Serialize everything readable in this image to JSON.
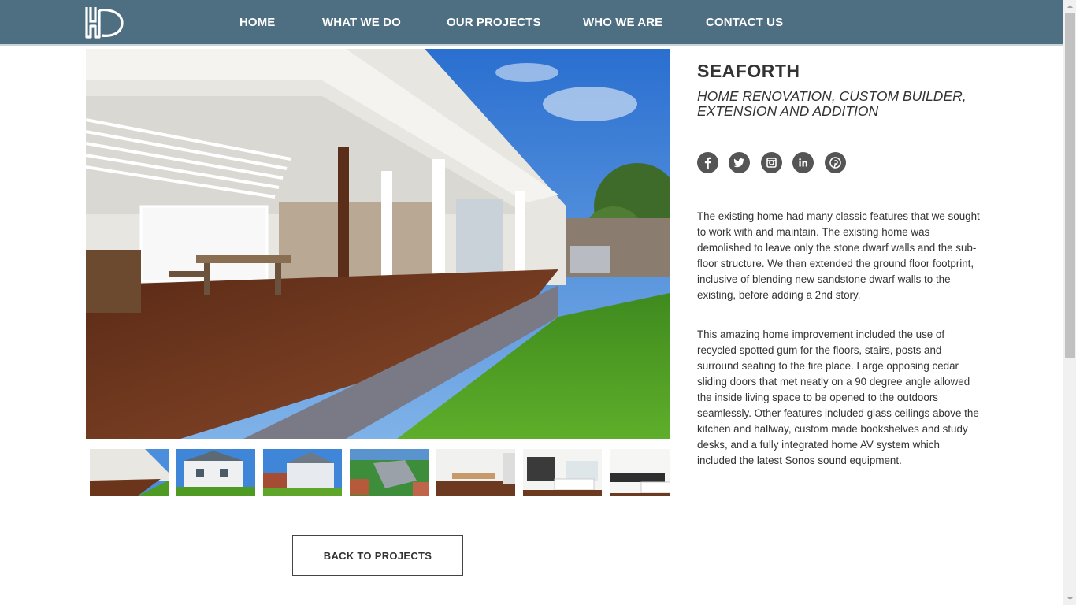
{
  "header": {
    "logo_alt": "WD",
    "nav": [
      "HOME",
      "WHAT WE DO",
      "OUR PROJECTS",
      "WHO WE ARE",
      "CONTACT US"
    ]
  },
  "project": {
    "title": "SEAFORTH",
    "subtitle": "HOME RENOVATION, CUSTOM BUILDER, EXTENSION AND ADDITION",
    "description": [
      "The existing home had many classic features that we sought to work with and maintain. The existing home was demolished to leave only the stone dwarf walls and the sub-floor structure. We then extended the ground floor footprint, inclusive of blending new sandstone dwarf walls to the existing, before adding a 2nd story.",
      "This amazing home improvement included the use of recycled spotted gum for the floors, stairs, posts and surround seating to the fire place. Large opposing cedar sliding doors that met neatly on a 90 degree angle allowed the inside living space to be opened to the outdoors seamlessly. Other features included glass ceilings above the kitchen and hallway, custom made bookshelves and study desks, and a fully integrated home AV system which included the latest Sonos sound equipment."
    ]
  },
  "social_icons": [
    "facebook-icon",
    "twitter-icon",
    "instagram-icon",
    "linkedin-icon",
    "pinterest-icon"
  ],
  "thumbnails": [
    "deck-exterior",
    "house-front",
    "house-street",
    "aerial-roof",
    "kitchen-dining",
    "kitchen-white",
    "kitchen-bench"
  ],
  "back_button": "BACK TO PROJECTS",
  "colors": {
    "header_bg": "#4e6e82",
    "text": "#333333",
    "social_bg": "#555555"
  }
}
